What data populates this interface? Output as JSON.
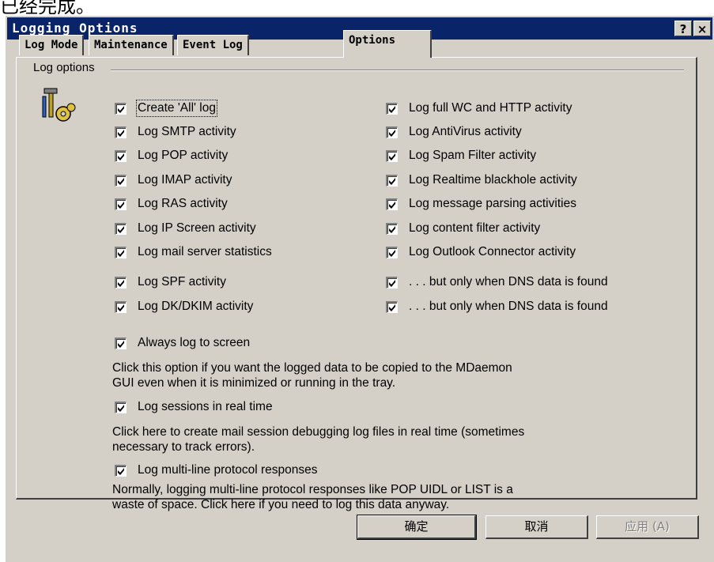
{
  "top_text": "已经完成。",
  "window": {
    "title": "Logging Options",
    "help_btn": "?",
    "close_btn": "×"
  },
  "tabs": [
    {
      "label": "Log Mode",
      "active": false
    },
    {
      "label": "Maintenance",
      "active": false
    },
    {
      "label": "Event Log",
      "active": false
    },
    {
      "label": "Options",
      "active": true
    }
  ],
  "group_label": "Log options",
  "left_column": [
    {
      "label": "Create 'All' log",
      "checked": true
    },
    {
      "label": "Log SMTP activity",
      "checked": true
    },
    {
      "label": "Log POP activity",
      "checked": true
    },
    {
      "label": "Log IMAP activity",
      "checked": true
    },
    {
      "label": "Log RAS activity",
      "checked": true
    },
    {
      "label": "Log IP Screen activity",
      "checked": true
    },
    {
      "label": "Log mail server statistics",
      "checked": true
    },
    {
      "label": "Log SPF activity",
      "checked": true
    },
    {
      "label": "Log DK/DKIM activity",
      "checked": true
    }
  ],
  "right_column": [
    {
      "label": "Log full WC and HTTP activity",
      "checked": true
    },
    {
      "label": "Log AntiVirus activity",
      "checked": true
    },
    {
      "label": "Log Spam Filter activity",
      "checked": true
    },
    {
      "label": "Log Realtime blackhole activity",
      "checked": true
    },
    {
      "label": "Log message parsing activities",
      "checked": true
    },
    {
      "label": "Log content filter activity",
      "checked": true
    },
    {
      "label": "Log Outlook Connector activity",
      "checked": true
    },
    {
      "label": ". . . but only when DNS data is found",
      "checked": true
    },
    {
      "label": ". . . but only when DNS data is found",
      "checked": true
    }
  ],
  "always_log": {
    "label": "Always log to screen",
    "checked": true,
    "desc1": "Click this option if you want the logged data to be copied to the MDaemon",
    "desc2": "GUI even when it is minimized or running in the tray."
  },
  "realtime": {
    "label": "Log sessions in real time",
    "checked": true,
    "desc1": "Click here to create mail session debugging log files in real time (sometimes",
    "desc2": "necessary to track errors)."
  },
  "multiline": {
    "label": "Log multi-line protocol responses",
    "checked": true,
    "desc1": "Normally, logging multi-line protocol responses like POP UIDL or LIST is a",
    "desc2": "waste of space.  Click here if you need to log this data anyway."
  },
  "buttons": {
    "ok": "确定",
    "cancel": "取消",
    "apply": "应用 (A)"
  }
}
